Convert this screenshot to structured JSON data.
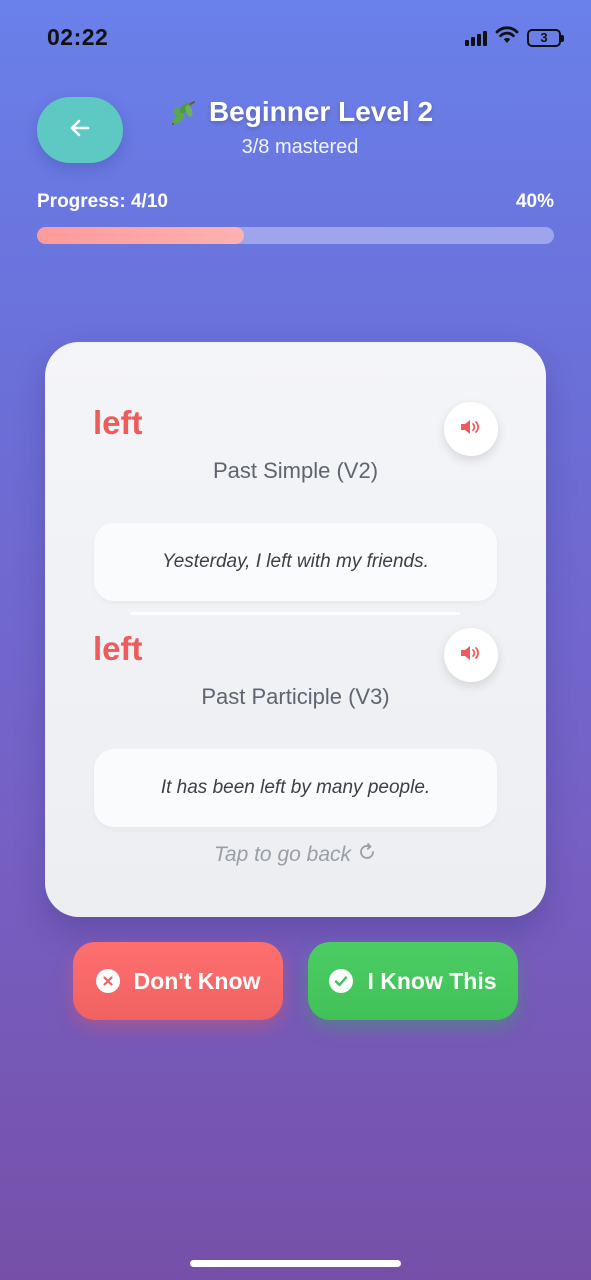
{
  "status_bar": {
    "time": "02:22",
    "battery_level": "3",
    "icons": [
      "signal-icon",
      "wifi-icon",
      "battery-icon"
    ]
  },
  "header": {
    "back_icon": "arrow-left-icon",
    "title_icon": "leaf-icon",
    "title": "Beginner Level 2",
    "subtitle": "3/8 mastered"
  },
  "progress": {
    "label": "Progress: 4/10",
    "percent_label": "40%",
    "fraction": 0.4
  },
  "card": {
    "forms": [
      {
        "word": "left",
        "form_label": "Past Simple (V2)",
        "example": "Yesterday, I left with my friends.",
        "audio_icon": "speaker-icon"
      },
      {
        "word": "left",
        "form_label": "Past Participle (V3)",
        "example": "It has been left by many people.",
        "audio_icon": "speaker-icon"
      }
    ],
    "hint": "Tap to go back",
    "hint_icon": "refresh-icon"
  },
  "actions": {
    "dont_know_label": "Don't Know",
    "know_label": "I Know This"
  },
  "colors": {
    "accent_red": "#ef5a5a",
    "accent_green": "#43c55b",
    "back_button": "#5ec9c2",
    "progress_fill": "#ff9a9a"
  }
}
